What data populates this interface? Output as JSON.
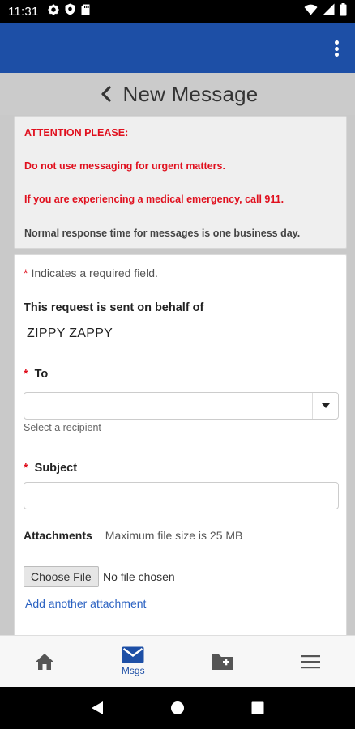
{
  "status_bar": {
    "time": "11:31",
    "icons": [
      "gear-icon",
      "shield-icon",
      "sd-card-icon",
      "wifi-icon",
      "signal-icon",
      "battery-icon"
    ]
  },
  "app_bar": {
    "background": "#1d4fa6",
    "menu_icon": "kebab-menu-icon"
  },
  "header": {
    "title": "New Message",
    "back_icon": "chevron-left-icon"
  },
  "attention": {
    "heading": "ATTENTION PLEASE:",
    "line1": "Do not use messaging for urgent matters.",
    "line2": "If you are experiencing a medical emergency, call 911.",
    "line3": "Normal response time for messages is one business day.",
    "alert_color": "#e0101e"
  },
  "form": {
    "required_star": "*",
    "required_note": "Indicates a required field.",
    "behalf_label": "This request is sent on behalf of",
    "behalf_value": "ZIPPY ZAPPY",
    "to_label": "To",
    "to_value": "",
    "to_helper": "Select a recipient",
    "subject_label": "Subject",
    "subject_value": "",
    "attachments_label": "Attachments",
    "attachments_hint": "Maximum file size is 25 MB",
    "choose_file_label": "Choose File",
    "file_status": "No file chosen",
    "add_attachment_link": "Add another attachment"
  },
  "bottom_nav": {
    "items": [
      {
        "icon": "home-icon",
        "label": ""
      },
      {
        "icon": "mail-icon",
        "label": "Msgs"
      },
      {
        "icon": "folder-plus-icon",
        "label": ""
      },
      {
        "icon": "hamburger-menu-icon",
        "label": ""
      }
    ],
    "active_color": "#1d4fa6"
  },
  "system_nav": {
    "icons": [
      "back-triangle-icon",
      "home-circle-icon",
      "recents-square-icon"
    ]
  }
}
